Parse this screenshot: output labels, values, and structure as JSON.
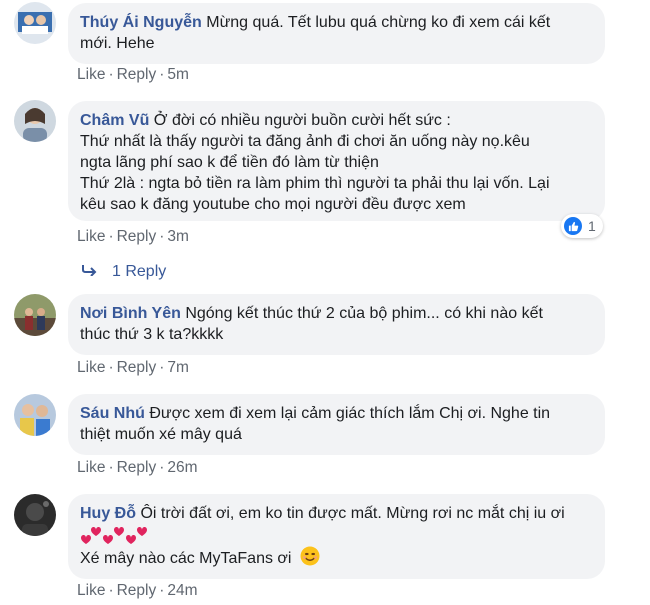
{
  "comments": [
    {
      "author": "Thúy Ái Nguyễn",
      "text_lines": [
        "Mừng quá. Tết lubu quá chừng ko đi xem cái kết",
        "mới. Hehe"
      ],
      "like": "Like",
      "reply": "Reply",
      "time": "5m"
    },
    {
      "author": "Châm Vũ",
      "text_lines": [
        "Ở đời có nhiều người buồn cười hết sức :",
        "Thứ nhất là thấy người ta đăng ảnh đi chơi ăn uống này nọ.kêu",
        "ngta lãng phí sao k để tiền đó làm từ thiện",
        "Thứ 2là : ngta bỏ tiền ra làm phim thì người ta phải thu lại vốn. Lại",
        "kêu sao k đăng youtube cho mọi người đều được xem"
      ],
      "like": "Like",
      "reply": "Reply",
      "time": "3m",
      "reaction_count": "1",
      "replies_label": "1 Reply"
    },
    {
      "author": "Nơi Bình Yên",
      "text_lines": [
        "Ngóng kết thúc thứ 2 của bộ phim... có khi nào kết",
        "thúc thứ 3 k ta?kkkk"
      ],
      "like": "Like",
      "reply": "Reply",
      "time": "7m"
    },
    {
      "author": "Sáu Nhú",
      "text_lines": [
        "Được xem đi xem lại cảm giác thích lắm Chị ơi. Nghe tin",
        "thiệt muốn xé mây quá"
      ],
      "like": "Like",
      "reply": "Reply",
      "time": "26m"
    },
    {
      "author": "Huy Đỗ",
      "text_lines": [
        "Ôi trời đất ơi, em ko tin được mất. Mừng rơi nc mắt chị iu ơi",
        "Xé mây nào các MyTaFans ơi"
      ],
      "like": "Like",
      "reply": "Reply",
      "time": "24m"
    }
  ],
  "separator": "·",
  "colors": {
    "author": "#385898",
    "bubble": "#f2f3f5",
    "action": "#606770",
    "like_blue": "#1877f2",
    "heart": "#e0245e"
  },
  "icons": [
    "thumbs-up-icon",
    "reply-arrow-icon",
    "hearts-emoji-icon",
    "smiling-face-emoji-icon"
  ]
}
